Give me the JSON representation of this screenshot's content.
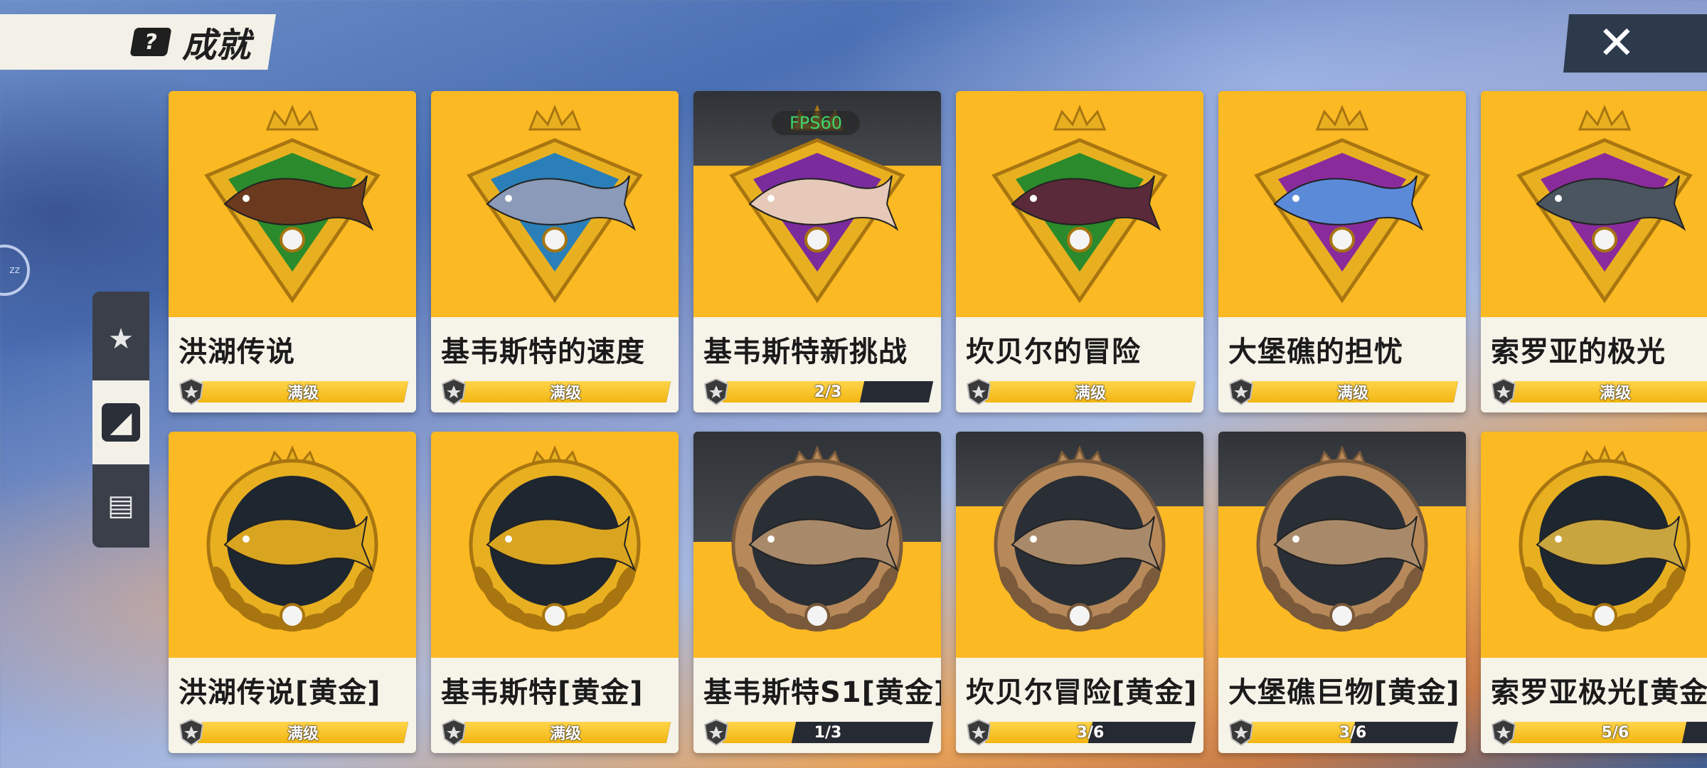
{
  "header": {
    "title": "成就",
    "help_glyph": "?",
    "close_glyph": "✕"
  },
  "sidebar": {
    "ring_label": "zz",
    "tabs": [
      {
        "icon": "star-shield-icon",
        "glyph": "★",
        "active": false
      },
      {
        "icon": "shark-fin-book-icon",
        "glyph": "◢",
        "active": true
      },
      {
        "icon": "fish-album-icon",
        "glyph": "▤",
        "active": false
      }
    ]
  },
  "overlay": {
    "fps": "FPS60"
  },
  "cards": [
    {
      "name": "洪湖传说",
      "progress_label": "满级",
      "progress": 1.0,
      "style": "diamond",
      "fish_color": "#6b3a1e",
      "frame_inner": "#2b8a2b",
      "muted": false
    },
    {
      "name": "基韦斯特的速度",
      "progress_label": "满级",
      "progress": 1.0,
      "style": "diamond",
      "fish_color": "#8a9ab8",
      "frame_inner": "#2a7fb8",
      "muted": false
    },
    {
      "name": "基韦斯特新挑战",
      "progress_label": "2/3",
      "progress": 0.667,
      "style": "diamond",
      "fish_color": "#e6c9b8",
      "frame_inner": "#7a2b9c",
      "muted": false
    },
    {
      "name": "坎贝尔的冒险",
      "progress_label": "满级",
      "progress": 1.0,
      "style": "diamond",
      "fish_color": "#5a2a3a",
      "frame_inner": "#2b8a2b",
      "muted": false
    },
    {
      "name": "大堡礁的担忧",
      "progress_label": "满级",
      "progress": 1.0,
      "style": "diamond",
      "fish_color": "#5b8ad9",
      "frame_inner": "#8a2b9c",
      "muted": false
    },
    {
      "name": "索罗亚的极光",
      "progress_label": "满级",
      "progress": 1.0,
      "style": "diamond",
      "fish_color": "#4a5560",
      "frame_inner": "#8a2b9c",
      "muted": false
    },
    {
      "name": "洪湖传说[黄金]",
      "progress_label": "满级",
      "progress": 1.0,
      "style": "wreath",
      "fish_color": "#d9a520",
      "frame_inner": "#1e2630",
      "muted": false
    },
    {
      "name": "基韦斯特[黄金]",
      "progress_label": "满级",
      "progress": 1.0,
      "style": "wreath",
      "fish_color": "#d9a520",
      "frame_inner": "#1e2630",
      "muted": false
    },
    {
      "name": "基韦斯特S1[黄金]",
      "progress_label": "1/3",
      "progress": 0.333,
      "style": "wreath",
      "fish_color": "#a88a6a",
      "frame_inner": "#2a2f36",
      "muted": true
    },
    {
      "name": "坎贝尔冒险[黄金]",
      "progress_label": "3/6",
      "progress": 0.5,
      "style": "wreath",
      "fish_color": "#a88a6a",
      "frame_inner": "#2a2f36",
      "muted": true
    },
    {
      "name": "大堡礁巨物[黄金]",
      "progress_label": "3/6",
      "progress": 0.5,
      "style": "wreath",
      "fish_color": "#a88a6a",
      "frame_inner": "#2a2f36",
      "muted": true
    },
    {
      "name": "索罗亚极光[黄金",
      "progress_label": "5/6",
      "progress": 0.833,
      "style": "wreath",
      "fish_color": "#c9a540",
      "frame_inner": "#1e2630",
      "muted": false
    }
  ]
}
